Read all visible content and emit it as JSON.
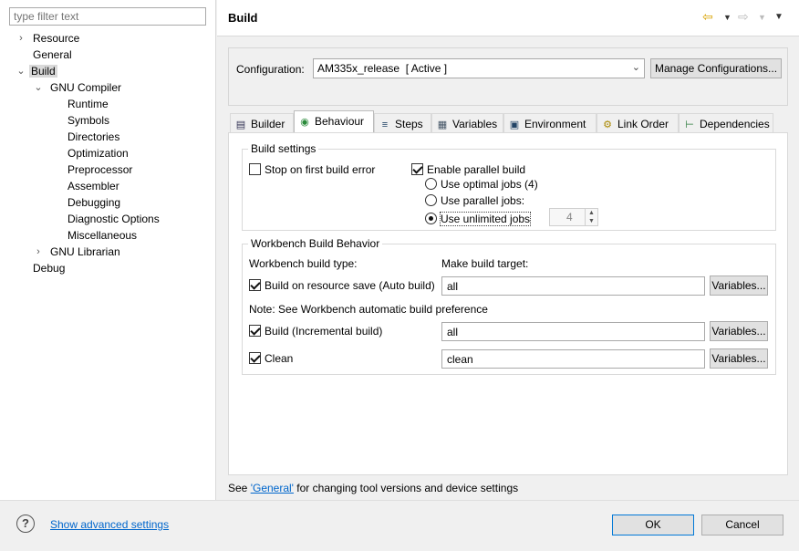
{
  "filter": {
    "placeholder": "type filter text"
  },
  "tree": {
    "resource": "Resource",
    "general": "General",
    "build": "Build",
    "gnu_compiler": "GNU Compiler",
    "runtime": "Runtime",
    "symbols": "Symbols",
    "directories": "Directories",
    "optimization": "Optimization",
    "preprocessor": "Preprocessor",
    "assembler": "Assembler",
    "debugging": "Debugging",
    "diagnostic_options": "Diagnostic Options",
    "miscellaneous": "Miscellaneous",
    "gnu_librarian": "GNU Librarian",
    "debug": "Debug"
  },
  "header": {
    "title": "Build"
  },
  "config": {
    "label": "Configuration:",
    "value": "AM335x_release  [ Active ]",
    "manage_label": "Manage Configurations..."
  },
  "tabs": {
    "builder": "Builder",
    "behaviour": "Behaviour",
    "steps": "Steps",
    "variables": "Variables",
    "environment": "Environment",
    "link_order": "Link Order",
    "dependencies": "Dependencies"
  },
  "build_settings": {
    "title": "Build settings",
    "stop_on_first_error": "Stop on first build error",
    "enable_parallel": "Enable parallel build",
    "use_optimal_jobs": "Use optimal jobs (4)",
    "use_parallel_jobs": "Use parallel jobs:",
    "parallel_jobs_value": "4",
    "use_unlimited_jobs": "Use unlimited jobs"
  },
  "workbench": {
    "title": "Workbench Build Behavior",
    "build_type_label": "Workbench build type:",
    "make_target_label": "Make build target:",
    "auto_build": "Build on resource save (Auto build)",
    "auto_build_target": "all",
    "note": "Note: See Workbench automatic build preference",
    "incremental_build": "Build (Incremental build)",
    "incremental_target": "all",
    "clean": "Clean",
    "clean_target": "clean",
    "variables_label": "Variables..."
  },
  "see_note": {
    "prefix": "See ",
    "link": "'General'",
    "suffix": " for changing tool versions and device settings"
  },
  "footer": {
    "help_glyph": "?",
    "advanced_link": "Show advanced settings",
    "ok": "OK",
    "cancel": "Cancel"
  }
}
